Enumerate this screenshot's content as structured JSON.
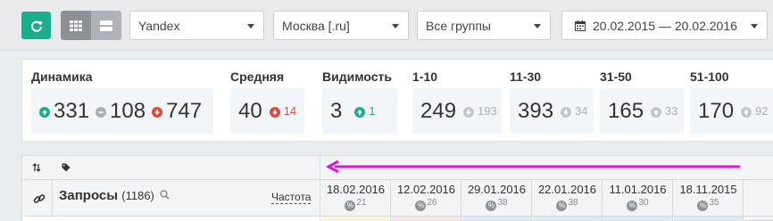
{
  "toolbar": {
    "search_engine": "Yandex",
    "region": "Москва [.ru]",
    "group": "Все группы",
    "date_range": "20.02.2015 — 20.02.2016"
  },
  "stats": {
    "dynamics": {
      "label": "Динамика",
      "up": "331",
      "neutral": "108",
      "down": "747"
    },
    "average": {
      "label": "Средняя",
      "value": "40",
      "delta": "14"
    },
    "visibility": {
      "label": "Видимость",
      "value": "3",
      "delta": "1"
    },
    "range_1_10": {
      "label": "1-10",
      "value": "249",
      "delta": "193"
    },
    "range_11_30": {
      "label": "11-30",
      "value": "393",
      "delta": "34"
    },
    "range_31_50": {
      "label": "31-50",
      "value": "165",
      "delta": "33"
    },
    "range_51_100": {
      "label": "51-100",
      "value": "170",
      "delta": "92"
    }
  },
  "table": {
    "queries_label": "Запросы",
    "queries_count": "(1186)",
    "frequency_label": "Частота",
    "columns": [
      {
        "date": "18.02.2016",
        "pct": "21"
      },
      {
        "date": "12.02.2016",
        "pct": "26"
      },
      {
        "date": "29.01.2016",
        "pct": "38"
      },
      {
        "date": "22.01.2016",
        "pct": "38"
      },
      {
        "date": "11.01.2016",
        "pct": "30"
      },
      {
        "date": "18.11.2015",
        "pct": "35"
      }
    ],
    "row_colors": [
      "#fdf4d9",
      "#fbe3e3",
      "#dde9f5",
      "#dde9f5",
      "#dde9f5",
      "#dde9f5"
    ]
  },
  "colors": {
    "accent": "#1aaf8b",
    "danger": "#e0483e",
    "annotation_arrow": "#e413dc"
  }
}
